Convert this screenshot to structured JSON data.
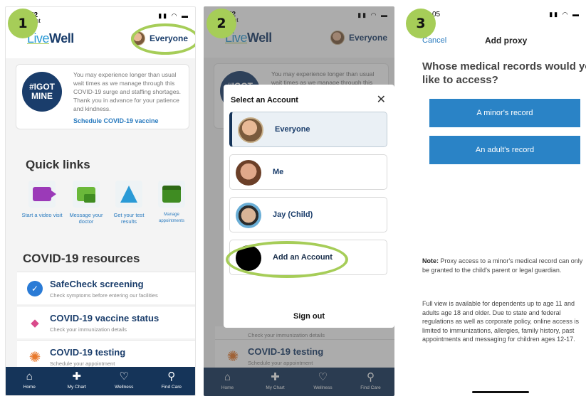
{
  "badges": [
    "1",
    "2",
    "3"
  ],
  "status": {
    "time1": "52",
    "time2": "52",
    "time3": "05",
    "carrier": "light"
  },
  "header": {
    "logo_live": "Live",
    "logo_well": "Well",
    "account_label": "Everyone"
  },
  "notice": {
    "seal_line1": "#IGOT",
    "seal_line2": "MINE",
    "text": "You may experience longer than usual wait times as we manage through this COVID-19 surge and staffing shortages. Thank you in advance for your patience and kindness.",
    "link": "Schedule COVID-19 vaccine"
  },
  "quick_links": {
    "title": "Quick links",
    "items": [
      {
        "label": "Start a video visit",
        "icon": "video-icon"
      },
      {
        "label": "Message your doctor",
        "icon": "message-icon"
      },
      {
        "label": "Get your test results",
        "icon": "flask-icon"
      },
      {
        "label": "Manage appointments",
        "icon": "calendar-icon"
      }
    ]
  },
  "covid": {
    "title": "COVID-19 resources",
    "items": [
      {
        "title": "SafeCheck screening",
        "sub": "Check symptoms before entering our facilities"
      },
      {
        "title": "COVID-19 vaccine status",
        "sub": "Check your immunization details"
      },
      {
        "title": "COVID-19 testing",
        "sub": "Schedule your appointment"
      }
    ]
  },
  "nav": [
    {
      "label": "Home",
      "icon": "home-icon"
    },
    {
      "label": "My Chart",
      "icon": "plus-icon"
    },
    {
      "label": "Wellness",
      "icon": "heart-icon"
    },
    {
      "label": "Find Care",
      "icon": "search-icon"
    }
  ],
  "select_account": {
    "title": "Select an Account",
    "options": [
      {
        "label": "Everyone",
        "selected": true
      },
      {
        "label": "Me",
        "selected": false
      },
      {
        "label": "Jay (Child)",
        "selected": false
      },
      {
        "label": "Add an Account",
        "selected": false
      }
    ],
    "sign_out": "Sign out",
    "behind_sub": "Check your immunization details"
  },
  "proxy": {
    "cancel": "Cancel",
    "title": "Add proxy",
    "question": "Whose medical records would you like to access?",
    "buttons": [
      "A minor's record",
      "An adult's record"
    ],
    "note_label": "Note:",
    "note_text": " Proxy access to a minor's medical record can only be granted to the child's parent or legal guardian.",
    "full_view": "Full view is available for dependents up to age 11 and adults age 18 and older. Due to state and federal regulations as well as corporate policy, online access is limited to immunizations, allergies, family history, past appointments and messaging for children ages 12-17."
  },
  "colors": {
    "accent_green": "#a6cd58",
    "navy": "#153459",
    "button_blue": "#2a83c6",
    "link_blue": "#2a7bbf"
  }
}
